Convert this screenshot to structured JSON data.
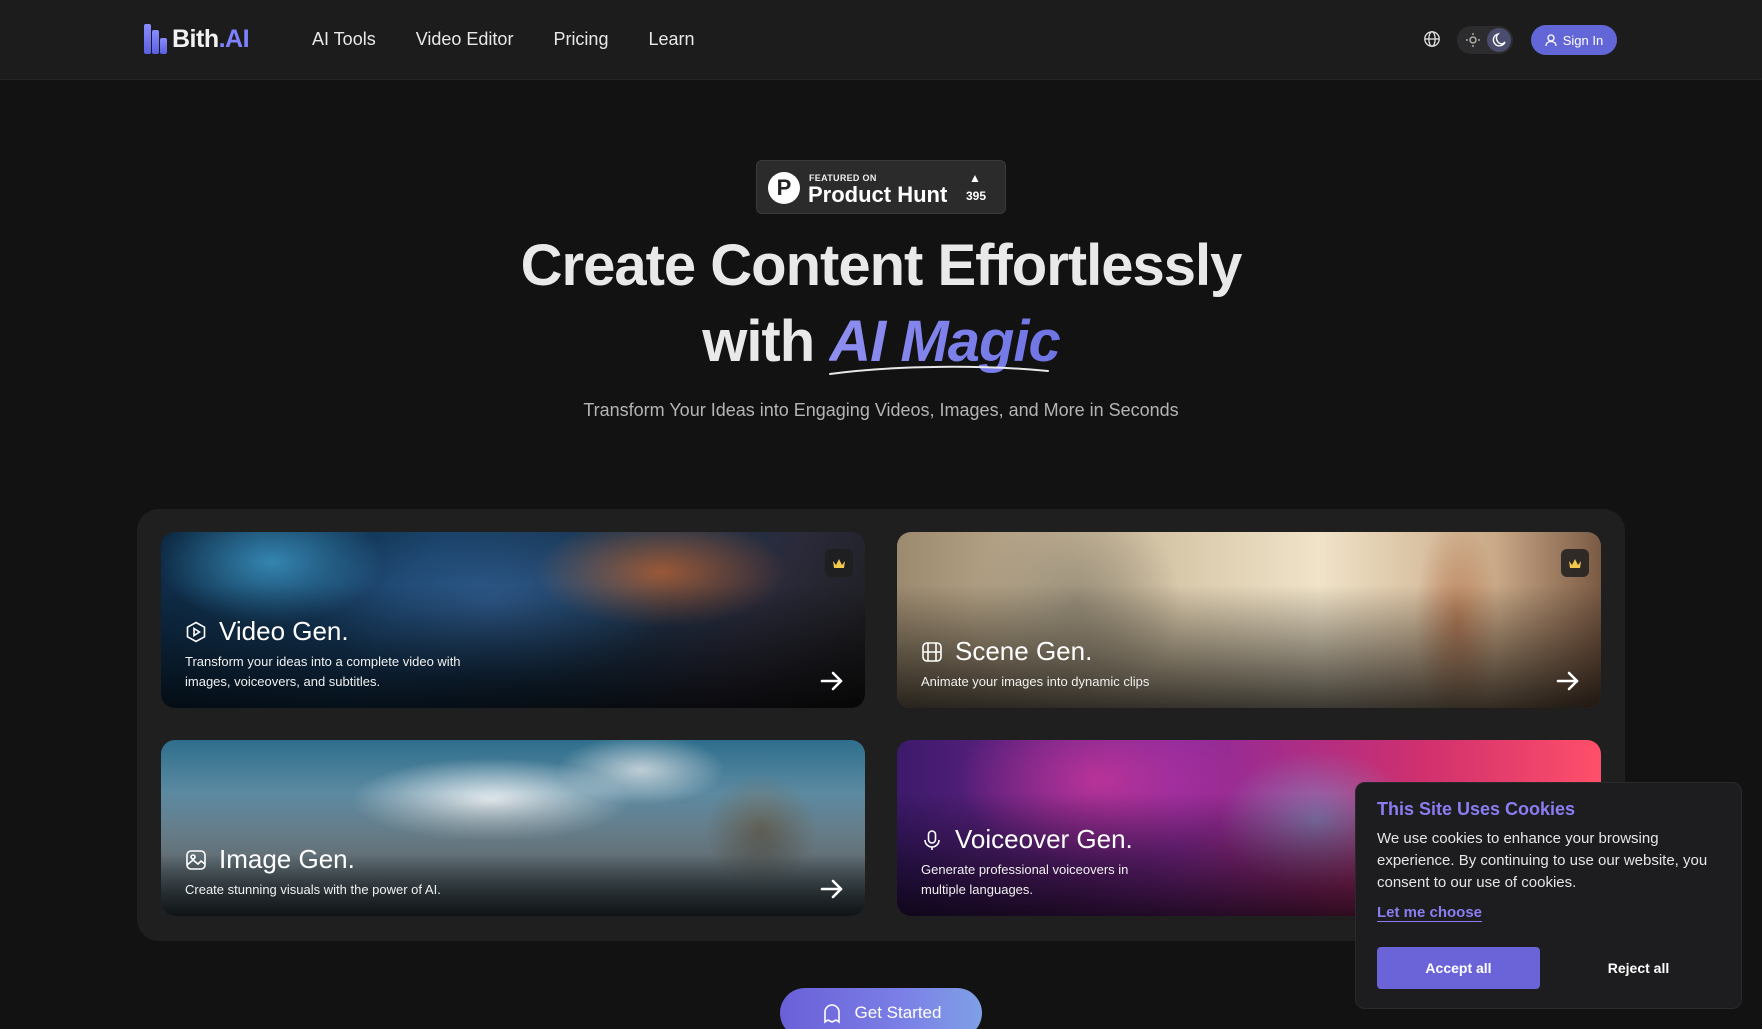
{
  "brand": {
    "name": "Bith",
    "suffix": ".AI"
  },
  "nav": {
    "links": [
      "AI Tools",
      "Video Editor",
      "Pricing",
      "Learn"
    ],
    "sign_in": "Sign In"
  },
  "product_hunt": {
    "featured": "FEATURED ON",
    "name": "Product Hunt",
    "votes": "395"
  },
  "hero": {
    "line1": "Create Content Effortlessly",
    "line2_prefix": "with ",
    "line2_highlight": "AI Magic",
    "subtitle": "Transform Your Ideas into Engaging Videos, Images, and More in Seconds"
  },
  "cards": [
    {
      "title": "Video Gen.",
      "desc": "Transform your ideas into a complete video with images, voiceovers, and subtitles.",
      "icon": "video-icon",
      "premium": true
    },
    {
      "title": "Scene Gen.",
      "desc": "Animate your images into dynamic clips",
      "icon": "film-icon",
      "premium": true
    },
    {
      "title": "Image Gen.",
      "desc": "Create stunning visuals with the power of AI.",
      "icon": "image-icon",
      "premium": false
    },
    {
      "title": "Voiceover Gen.",
      "desc": "Generate professional voiceovers in multiple languages.",
      "icon": "microphone-icon",
      "premium": false
    }
  ],
  "cta": {
    "label": "Get Started"
  },
  "cookie": {
    "title": "This Site Uses Cookies",
    "body": "We use cookies to enhance your browsing experience. By continuing to use our website, you consent to our use of cookies.",
    "choose": "Let me choose",
    "accept": "Accept all",
    "reject": "Reject all"
  },
  "colors": {
    "accent": "#6b64d8",
    "highlight": "#8a7df2",
    "background": "#121212"
  }
}
